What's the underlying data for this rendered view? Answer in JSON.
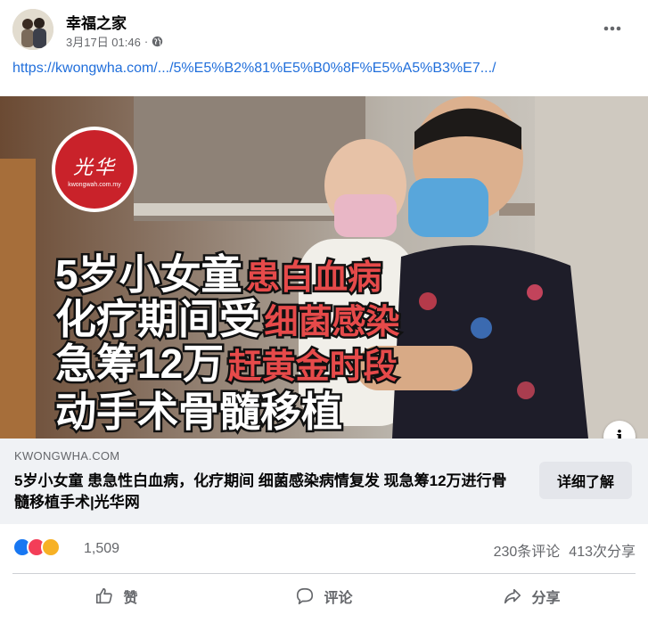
{
  "post": {
    "author": "幸福之家",
    "timestamp": "3月17日 01:46",
    "separator": "·",
    "privacy_icon": "globe-icon",
    "more_icon": "more-horizontal-icon",
    "link_text": "https://kwongwha.com/.../5%E5%B2%81%E5%B0%8F%E5%A5%B3%E7.../"
  },
  "preview": {
    "logo_text": "光华",
    "logo_sub": "kwongwah.com.my",
    "headline": [
      {
        "big": "5岁小女童",
        "small": "患白血病"
      },
      {
        "big": "化疗期间受",
        "small": "细菌感染"
      },
      {
        "big": "急筹12万",
        "small": "赶黄金时段"
      },
      {
        "big": "动手术骨髓移植",
        "small": ""
      }
    ],
    "info_label": "i"
  },
  "card": {
    "domain": "KWONGWHA.COM",
    "title": "5岁小女童 患急性白血病，化疗期间 细菌感染病情复发 现急筹12万进行骨髓移植手术|光华网",
    "learn_more": "详细了解"
  },
  "stats": {
    "reactions_count": "1,509",
    "comments": "230条评论",
    "shares": "413次分享",
    "reaction_colors": [
      "#1877f2",
      "#f33e58",
      "#f7b125"
    ]
  },
  "actions": {
    "like": "赞",
    "comment": "评论",
    "share": "分享"
  }
}
